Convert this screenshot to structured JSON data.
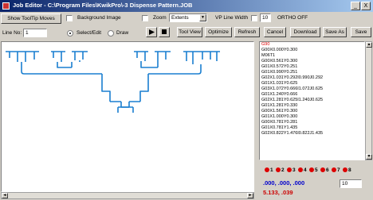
{
  "window": {
    "title": "Job Editor - C:\\Program Files\\KwikPro\\-3 Dispense Pattern.JOB",
    "minimize": "_",
    "close": "X"
  },
  "toolbar": {
    "show_tooltip_moves": "Show ToolTip Moves",
    "background_image": "Background Image",
    "zoom": "Zoom",
    "zoom_select": "Extents",
    "vp_line_width": "VP Line Width",
    "vp_line_width_value": "10",
    "ortho": "ORTHO OFF",
    "line_no_label": "Line No:",
    "line_no_value": "1",
    "select_edit": "Select/Edit",
    "draw": "Draw",
    "play_icon": "play-icon",
    "stop_icon": "stop-icon",
    "tool_view": "Tool View",
    "optimize": "Optimize",
    "refresh": "Refresh",
    "cancel": "Cancel",
    "download": "Download",
    "save_as": "Save As",
    "save": "Save"
  },
  "commands": [
    "G90",
    "G00X0.000Y0.300",
    "M06T1",
    "G00X0.561Y0.300",
    "G01X0.572Y0.251",
    "G01X0.990Y0.251",
    "G02X1.031Y0.292I0.990J0.292",
    "G01X1.031Y0.625",
    "G03X1.072Y0.666I1.072J0.625",
    "G01X1.240Y0.666",
    "G02X1.281Y0.625I1.240J0.625",
    "G01X1.281Y0.330",
    "G00X1.561Y0.300",
    "G01X1.000Y0.300",
    "G00X0.781Y0.281",
    "G01X0.781Y1.435",
    "G02X0.822Y1.476I0.822J1.435"
  ],
  "valves": [
    "1",
    "2",
    "3",
    "4",
    "5",
    "6",
    "7",
    "8"
  ],
  "valve_field": "10",
  "coords": {
    "position": ".000, .000, .000",
    "size": "5.133, .039"
  }
}
